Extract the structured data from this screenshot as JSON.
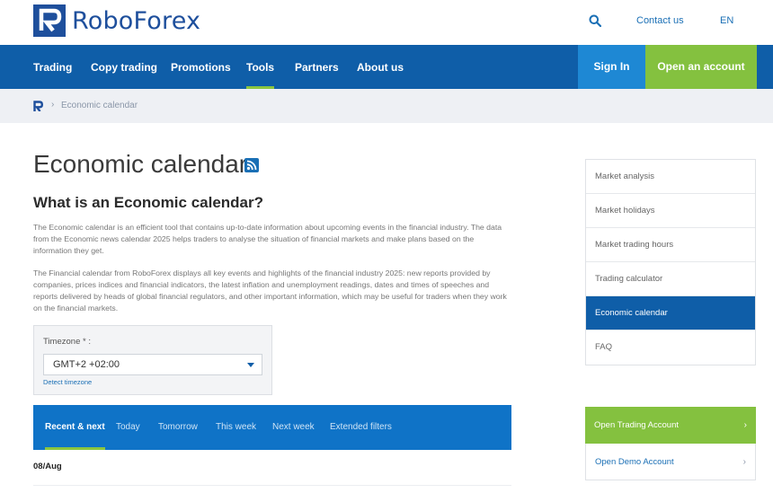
{
  "header": {
    "brand": "RoboForex",
    "contact_label": "Contact us",
    "lang_label": "EN"
  },
  "nav": {
    "items": [
      "Trading",
      "Copy trading",
      "Promotions",
      "Tools",
      "Partners",
      "About us"
    ],
    "active": "Tools",
    "sign_in": "Sign In",
    "open_account": "Open an account"
  },
  "breadcrumb": {
    "separator": "›",
    "current": "Economic calendar"
  },
  "main": {
    "title": "Economic calendar",
    "subtitle": "What is an Economic calendar?",
    "paragraph1": "The Economic calendar is an efficient tool that contains up-to-date information about upcoming events in the financial industry. The data from the Economic news calendar 2025 helps traders to analyse the situation of financial markets and make plans based on the information they get.",
    "paragraph2": "The Financial calendar from RoboForex displays all key events and highlights of the financial industry 2025: new reports provided by companies, prices indices and financial indicators, the latest inflation and unemployment readings, dates and times of speeches and reports delivered by heads of global financial regulators, and other important information, which may be useful for traders when they work on the financial markets."
  },
  "timezone": {
    "label": "Timezone * :",
    "value": "GMT+2 +02:00",
    "detect": "Detect timezone"
  },
  "tabs": {
    "items": [
      "Recent & next",
      "Today",
      "Tomorrow",
      "This week",
      "Next week",
      "Extended filters"
    ],
    "active": "Recent & next"
  },
  "calendar": {
    "date": "08/Aug"
  },
  "sidebar": {
    "items": [
      "Market analysis",
      "Market holidays",
      "Market trading hours",
      "Trading calculator",
      "Economic calendar",
      "FAQ"
    ],
    "active": "Economic calendar",
    "cta_primary": "Open Trading Account",
    "cta_secondary": "Open Demo Account",
    "chevron": "›"
  },
  "colors": {
    "brand_blue": "#0f5ea8",
    "accent_green": "#84c13f",
    "tab_blue": "#0f73c7"
  }
}
